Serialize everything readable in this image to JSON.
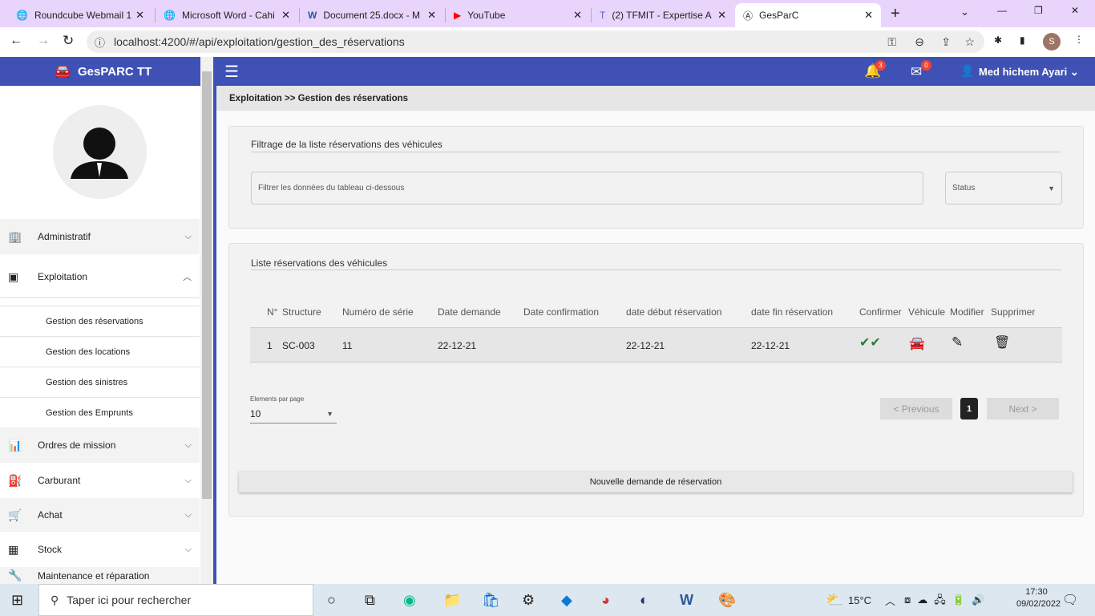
{
  "browser": {
    "tabs": [
      "Roundcube Webmail 1",
      "Microsoft Word - Cahi",
      "Document 25.docx - M",
      "YouTube",
      "(2) TFMIT - Expertise A",
      "GesParC"
    ],
    "url": "localhost:4200/#/api/exploitation/gestion_des_réservations",
    "profile": "S"
  },
  "app": {
    "title": "GesPARC TT",
    "notif_count": "3",
    "mail_count": "0",
    "user": "Med hichem Ayari"
  },
  "breadcrumb": "Exploitation >> Gestion des réservations",
  "sidebar": {
    "items": [
      {
        "label": "Administratif"
      },
      {
        "label": "Exploitation"
      },
      {
        "label": "Ordres de mission"
      },
      {
        "label": "Carburant"
      },
      {
        "label": "Achat"
      },
      {
        "label": "Stock"
      },
      {
        "label": "Maintenance et réparation"
      }
    ],
    "subitems": [
      "Gestion des réservations",
      "Gestion des locations",
      "Gestion des sinistres",
      "Gestion des Emprunts"
    ]
  },
  "filter": {
    "title": "Filtrage de la liste réservations des véhicules",
    "placeholder": "Filtrer les données du tableau ci-dessous",
    "status_label": "Status"
  },
  "list": {
    "title": "Liste réservations des véhicules",
    "headers": [
      "N°",
      "Structure",
      "Numéro de série",
      "Date demande",
      "Date confirmation",
      "date début réservation",
      "date fin réservation",
      "Confirmer",
      "Véhicule",
      "Modifier",
      "Supprimer"
    ],
    "rows": [
      {
        "n": "1",
        "structure": "SC-003",
        "serie": "11",
        "demande": "22-12-21",
        "confirmation": "",
        "debut": "22-12-21",
        "fin": "22-12-21"
      }
    ],
    "page_size_label": "Elements par page",
    "page_size": "10",
    "prev": "< Previous",
    "page": "1",
    "next": "Next >",
    "new_button": "Nouvelle demande de réservation"
  },
  "taskbar": {
    "search": "Taper ici pour rechercher",
    "temp": "15°C",
    "time": "17:30",
    "date": "09/02/2022"
  }
}
